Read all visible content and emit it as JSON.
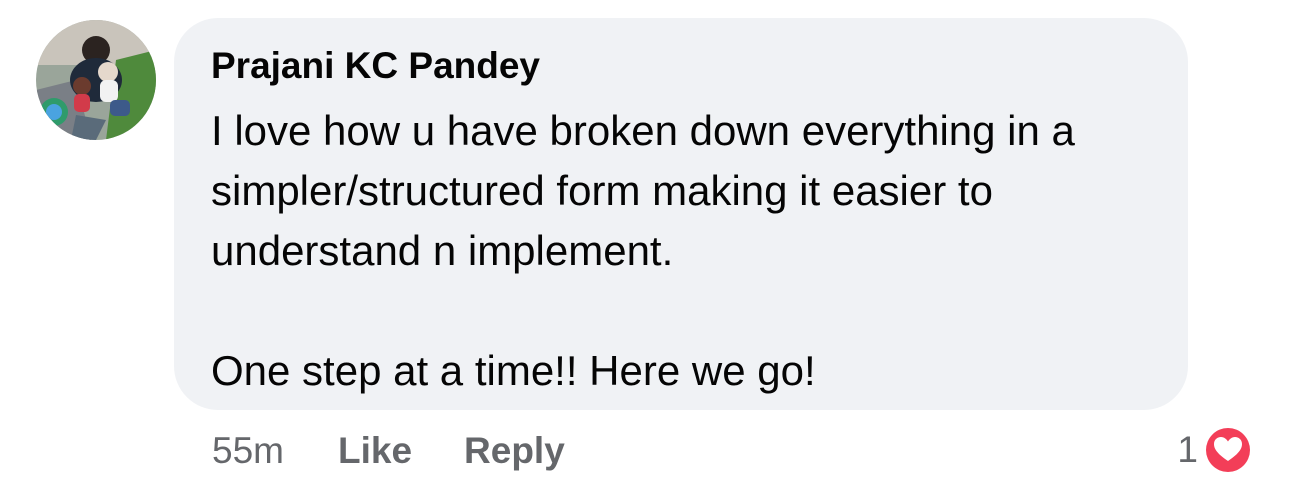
{
  "comment": {
    "author": "Prajani KC Pandey",
    "text": [
      "I love how u have broken down everything in a simpler/structured form making it easier to understand n implement.",
      "One step at a time!! Here we go!"
    ],
    "timestamp": "55m",
    "like_label": "Like",
    "reply_label": "Reply",
    "reaction_count": "1",
    "reaction_icon": "love-reaction-icon"
  },
  "colors": {
    "bubble_bg": "#f0f2f5",
    "text": "#050505",
    "secondary_text": "#65676b",
    "love_red": "#f33e58"
  }
}
